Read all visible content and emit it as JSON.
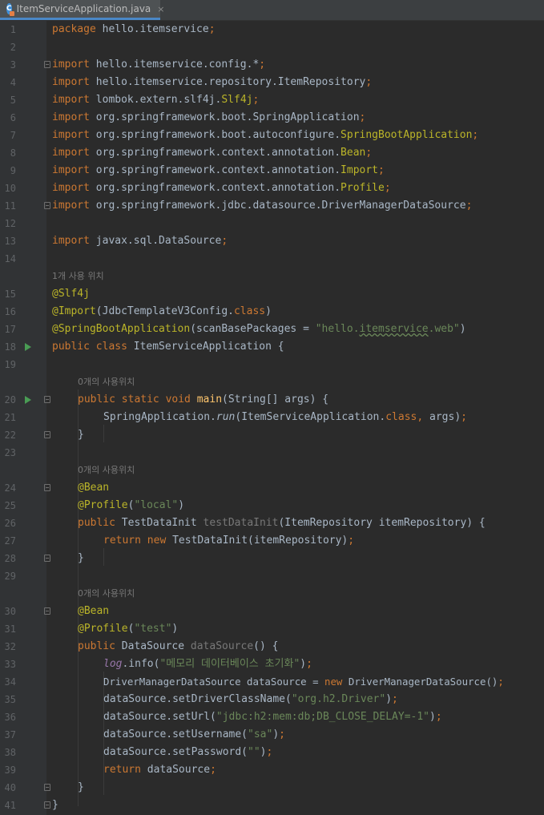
{
  "tab": {
    "label": "ItemServiceApplication.java",
    "close": "×",
    "icon_letter": "C"
  },
  "hints": {
    "h1": "1개 사용 위치",
    "h2": "0개의 사용위치",
    "h3": "0개의 사용위치",
    "h4": "0개의 사용위치"
  },
  "lines": {
    "l1": {
      "num": "1",
      "kw": "package",
      "rest": " hello.itemservice",
      "semi": ";"
    },
    "l2": {
      "num": "2"
    },
    "l3": {
      "num": "3",
      "kw": "import",
      "rest": " hello.itemservice.config.*",
      "semi": ";"
    },
    "l4": {
      "num": "4",
      "kw": "import",
      "rest": " hello.itemservice.repository.ItemRepository",
      "semi": ";"
    },
    "l5": {
      "num": "5",
      "kw": "import",
      "rest": " lombok.extern.slf4j.",
      "an": "Slf4j",
      "semi": ";"
    },
    "l6": {
      "num": "6",
      "kw": "import",
      "rest": " org.springframework.boot.SpringApplication",
      "semi": ";"
    },
    "l7": {
      "num": "7",
      "kw": "import",
      "rest": " org.springframework.boot.autoconfigure.",
      "an": "SpringBootApplication",
      "semi": ";"
    },
    "l8": {
      "num": "8",
      "kw": "import",
      "rest": " org.springframework.context.annotation.",
      "an": "Bean",
      "semi": ";"
    },
    "l9": {
      "num": "9",
      "kw": "import",
      "rest": " org.springframework.context.annotation.",
      "an": "Import",
      "semi": ";"
    },
    "l10": {
      "num": "10",
      "kw": "import",
      "rest": " org.springframework.context.annotation.",
      "an": "Profile",
      "semi": ";"
    },
    "l11": {
      "num": "11",
      "kw": "import",
      "rest": " org.springframework.jdbc.datasource.DriverManagerDataSource",
      "semi": ";"
    },
    "l12": {
      "num": "12"
    },
    "l13": {
      "num": "13",
      "kw": "import",
      "rest": " javax.sql.DataSource",
      "semi": ";"
    },
    "l14": {
      "num": "14"
    },
    "l15": {
      "num": "15",
      "an": "@Slf4j"
    },
    "l16": {
      "num": "16",
      "an": "@Import",
      "p1": "(JdbcTemplateV3Config.",
      "kw": "class",
      "p2": ")"
    },
    "l17": {
      "num": "17",
      "an": "@SpringBootApplication",
      "p1": "(scanBasePackages = ",
      "s1": "\"hello.",
      "s2": "itemservice",
      "s3": ".web\"",
      "p2": ")"
    },
    "l18": {
      "num": "18",
      "kw": "public class",
      "rest": " ItemServiceApplication {"
    },
    "l19": {
      "num": "19"
    },
    "l20": {
      "num": "20",
      "kw": "public static void",
      "fn": "main",
      "rest": "(String[] args) {"
    },
    "l21": {
      "num": "21",
      "p1": "SpringApplication.",
      "it": "run",
      "p2": "(ItemServiceApplication.",
      "kw": "class,",
      "p3": " args)",
      "semi": ";"
    },
    "l22": {
      "num": "22",
      "rest": "}"
    },
    "l23": {
      "num": "23"
    },
    "l24": {
      "num": "24",
      "an": "@Bean"
    },
    "l25": {
      "num": "25",
      "an": "@Profile",
      "p1": "(",
      "st": "\"local\"",
      "p2": ")"
    },
    "l26": {
      "num": "26",
      "kw": "public",
      "p1": " TestDataInit ",
      "gr": "testDataInit",
      "p2": "(ItemRepository itemRepository) {"
    },
    "l27": {
      "num": "27",
      "kw": "return new",
      "rest": " TestDataInit(itemRepository)",
      "semi": ";"
    },
    "l28": {
      "num": "28",
      "rest": "}"
    },
    "l29": {
      "num": "29"
    },
    "l30": {
      "num": "30",
      "an": "@Bean"
    },
    "l31": {
      "num": "31",
      "an": "@Profile",
      "p1": "(",
      "st": "\"test\"",
      "p2": ")"
    },
    "l32": {
      "num": "32",
      "kw": "public",
      "p1": " DataSource ",
      "gr": "dataSource",
      "p2": "() {"
    },
    "l33": {
      "num": "33",
      "pu": "log",
      "p1": ".info(",
      "st": "\"메모리 데이터베이스 초기화\"",
      "p2": ")",
      "semi": ";"
    },
    "l34": {
      "num": "34",
      "p1": "DriverManagerDataSource dataSource = ",
      "kw": "new",
      "p2": " DriverManagerDataSource()",
      "semi": ";"
    },
    "l35": {
      "num": "35",
      "p1": "dataSource.setDriverClassName(",
      "st": "\"org.h2.Driver\"",
      "p2": ")",
      "semi": ";"
    },
    "l36": {
      "num": "36",
      "p1": "dataSource.setUrl(",
      "st": "\"jdbc:h2:mem:db;DB_CLOSE_DELAY=-1\"",
      "p2": ")",
      "semi": ";"
    },
    "l37": {
      "num": "37",
      "p1": "dataSource.setUsername(",
      "st": "\"sa\"",
      "p2": ")",
      "semi": ";"
    },
    "l38": {
      "num": "38",
      "p1": "dataSource.setPassword(",
      "st": "\"\"",
      "p2": ")",
      "semi": ";"
    },
    "l39": {
      "num": "39",
      "kw": "return",
      "rest": " dataSource",
      "semi": ";"
    },
    "l40": {
      "num": "40",
      "rest": "}"
    },
    "l41": {
      "num": "41",
      "rest": "}"
    }
  },
  "colors": {
    "background": "#2b2b2b",
    "gutter": "#313335",
    "keyword": "#cc7832",
    "annotation": "#bbb529",
    "string": "#6a8759",
    "method": "#ffc66d",
    "field": "#9876aa",
    "text": "#a9b7c6",
    "line_number": "#606366",
    "hint": "#787878"
  },
  "icons": {
    "run": "run-gutter-icon",
    "fold": "fold-icon",
    "file": "java-class-icon"
  }
}
